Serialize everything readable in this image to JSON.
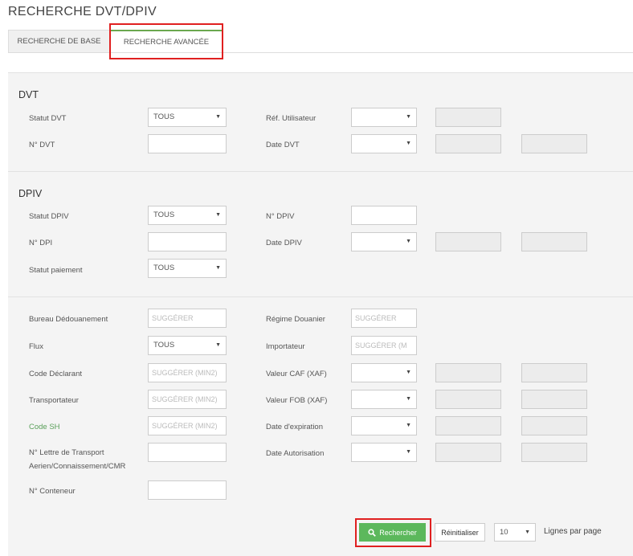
{
  "page": {
    "title": "RECHERCHE DVT/DPIV"
  },
  "tabs": [
    {
      "label": "RECHERCHE DE BASE"
    },
    {
      "label": "RECHERCHE AVANCÉE"
    }
  ],
  "dvt": {
    "heading": "DVT",
    "statut_label": "Statut DVT",
    "statut_value": "TOUS",
    "ref_label": "Réf. Utilisateur",
    "num_label": "N° DVT",
    "date_label": "Date DVT"
  },
  "dpiv": {
    "heading": "DPIV",
    "statut_label": "Statut DPIV",
    "statut_value": "TOUS",
    "numdpiv_label": "N° DPIV",
    "numdpi_label": "N° DPI",
    "date_label": "Date DPIV",
    "paiement_label": "Statut paiement",
    "paiement_value": "TOUS"
  },
  "other": {
    "bureau_label": "Bureau Dédouanement",
    "bureau_placeholder": "SUGGÉRER",
    "regime_label": "Régime Douanier",
    "regime_placeholder": "SUGGÉRER",
    "flux_label": "Flux",
    "flux_value": "TOUS",
    "importateur_label": "Importateur",
    "importateur_placeholder": "SUGGÉRER (M",
    "declarant_label": "Code Déclarant",
    "declarant_placeholder": "SUGGÉRER (MIN2)",
    "caf_label": "Valeur CAF (XAF)",
    "transporteur_label": "Transportateur",
    "transporteur_placeholder": "SUGGÉRER (MIN2)",
    "fob_label": "Valeur FOB (XAF)",
    "codesh_label": "Code SH",
    "codesh_placeholder": "SUGGÉRER (MIN2)",
    "expiration_label": "Date d'expiration",
    "lettre_label_1": "N° Lettre de Transport",
    "lettre_label_2": "Aerien/Connaissement/CMR",
    "autorisation_label": "Date Autorisation",
    "conteneur_label": "N° Conteneur"
  },
  "actions": {
    "search_label": "Rechercher",
    "reset_label": "Réinitialiser",
    "rows_value": "10",
    "rows_label": "Lignes par page"
  },
  "colors": {
    "accent_green": "#5cb85c",
    "highlight_red": "#e02020"
  },
  "icons": {
    "search": "search-icon",
    "dropdown": "caret-down-icon"
  }
}
